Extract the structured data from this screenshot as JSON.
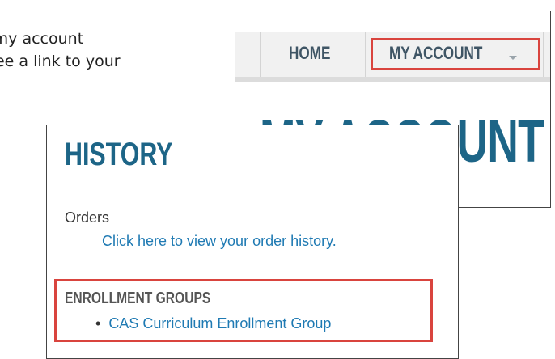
{
  "instructions": {
    "line1": "o my account",
    "line2": "n see a link to your"
  },
  "nav": {
    "home_label": "HOME",
    "account_label": "MY ACCOUNT",
    "page_heading": "MY ACCOUNT"
  },
  "history": {
    "title": "HISTORY",
    "orders_label": "Orders",
    "orders_link": "Click here to view your order history.",
    "enrollment_title": "ENROLLMENT GROUPS",
    "enrollment_items": [
      {
        "label": "CAS Curriculum Enrollment Group"
      }
    ]
  },
  "colors": {
    "highlight_border": "#d9443e",
    "heading_blue": "#1d6587",
    "link_blue": "#1f7ab3"
  }
}
